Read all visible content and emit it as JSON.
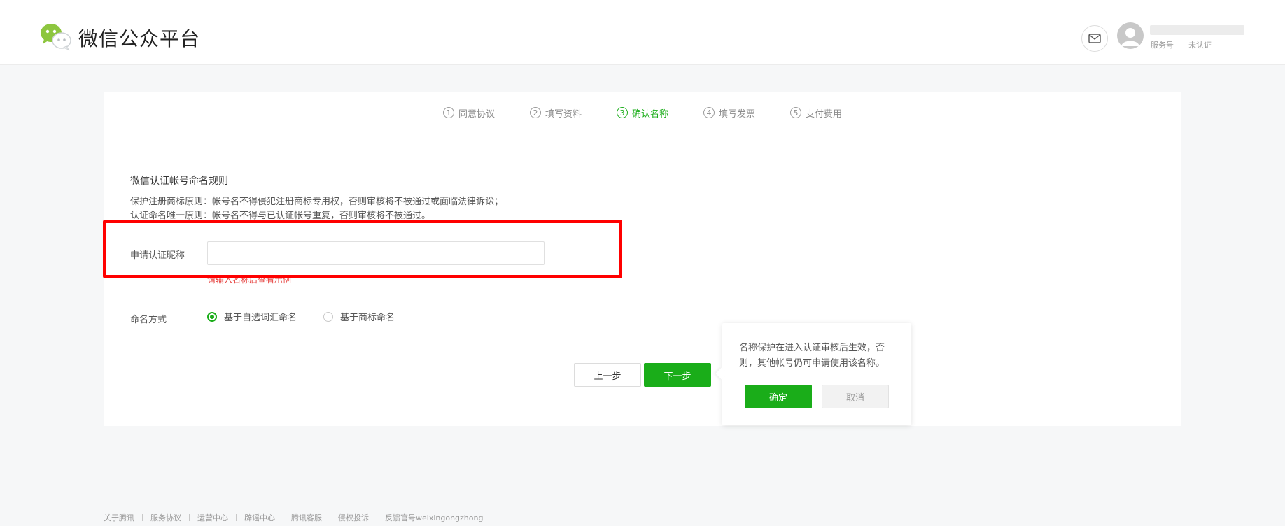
{
  "header": {
    "brand_title": "微信公众平台",
    "account_type": "服务号",
    "verify_status": "未认证"
  },
  "steps": [
    {
      "num": "1",
      "label": "同意协议",
      "active": false
    },
    {
      "num": "2",
      "label": "填写资料",
      "active": false
    },
    {
      "num": "3",
      "label": "确认名称",
      "active": true
    },
    {
      "num": "4",
      "label": "填写发票",
      "active": false
    },
    {
      "num": "5",
      "label": "支付费用",
      "active": false
    }
  ],
  "rules": {
    "title": "微信认证帐号命名规则",
    "line1": "保护注册商标原则：帐号名不得侵犯注册商标专用权，否则审核将不被通过或面临法律诉讼；",
    "line2": "认证命名唯一原则：帐号名不得与已认证帐号重复，否则审核将不被通过。"
  },
  "form": {
    "name_label": "申请认证昵称",
    "name_value": "",
    "hint": "请输入名称后查看示例",
    "naming_label": "命名方式",
    "option_custom": "基于自选词汇命名",
    "option_trademark": "基于商标命名",
    "selected": "基于自选词汇命名"
  },
  "actions": {
    "prev": "上一步",
    "next": "下一步"
  },
  "popover": {
    "text": "名称保护在进入认证审核后生效，否则，其他帐号仍可申请使用该名称。",
    "confirm": "确定",
    "cancel": "取消"
  },
  "footer": {
    "links": [
      "关于腾讯",
      "服务协议",
      "运营中心",
      "辟谣中心",
      "腾讯客服",
      "侵权投诉",
      "反馈官号weixingongzhong"
    ]
  },
  "colors": {
    "accent": "#1aad19",
    "highlight": "#ff0000",
    "background": "#f6f7f8"
  }
}
